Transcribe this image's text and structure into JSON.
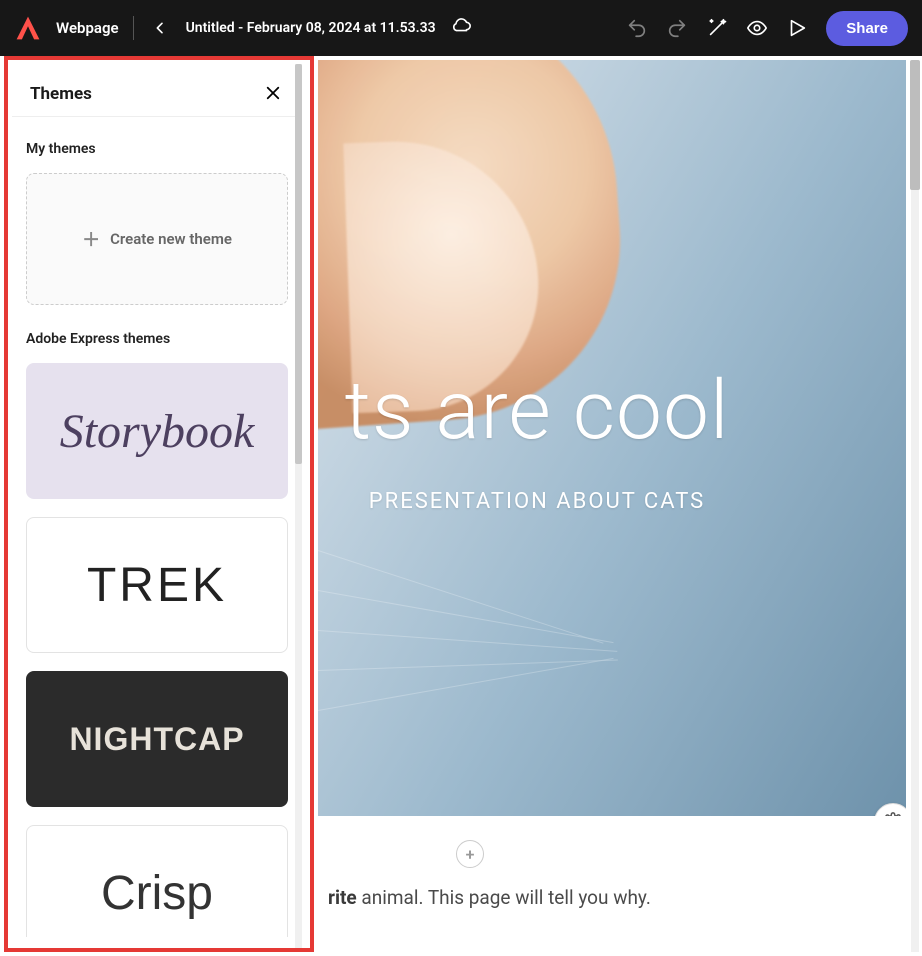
{
  "topbar": {
    "app_label": "Webpage",
    "doc_title": "Untitled - February 08, 2024 at 11.53.33",
    "share_label": "Share"
  },
  "panel": {
    "title": "Themes",
    "sections": {
      "my": "My themes",
      "express": "Adobe Express themes"
    },
    "create_label": "Create new theme",
    "themes": {
      "storybook": "Storybook",
      "trek": "TREK",
      "nightcap": "NIGHTCAP",
      "crisp": "Crisp"
    }
  },
  "hero": {
    "title_visible": "ts are cool",
    "subtitle_visible": "PRESENTATION ABOUT CATS"
  },
  "body": {
    "fragment_html": "rite",
    "fragment_tail": " animal. This page will tell you why."
  }
}
